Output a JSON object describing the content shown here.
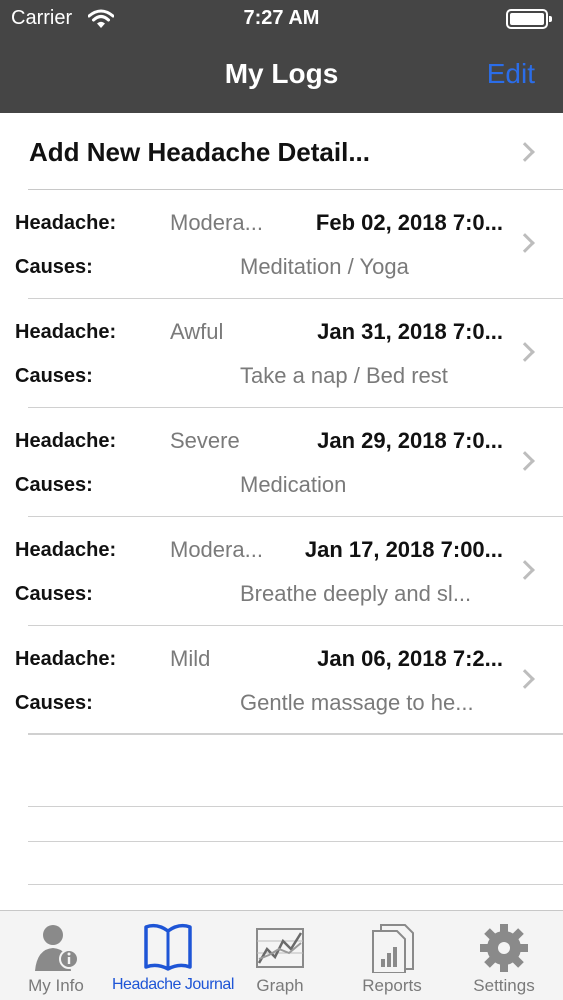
{
  "status_bar": {
    "carrier": "Carrier",
    "time": "7:27 AM"
  },
  "nav": {
    "title": "My Logs",
    "edit_label": "Edit",
    "accent": "#2b6de8"
  },
  "add_row": {
    "label": "Add New Headache Detail..."
  },
  "row_labels": {
    "headache": "Headache:",
    "causes": "Causes:"
  },
  "logs": [
    {
      "severity": "Modera...",
      "date": "Feb 02, 2018 7:0...",
      "cause": "Meditation / Yoga"
    },
    {
      "severity": "Awful",
      "date": "Jan 31, 2018 7:0...",
      "cause": "Take a nap / Bed rest"
    },
    {
      "severity": "Severe",
      "date": "Jan 29, 2018 7:0...",
      "cause": "Medication"
    },
    {
      "severity": "Modera...",
      "date": "Jan 17, 2018 7:00...",
      "cause": "Breathe deeply and sl..."
    },
    {
      "severity": "Mild",
      "date": "Jan 06, 2018 7:2...",
      "cause": "Gentle massage to he..."
    }
  ],
  "tabs": [
    {
      "label": "My Info",
      "icon": "person-info-icon"
    },
    {
      "label": "Headache Journal",
      "icon": "open-book-icon",
      "active": true
    },
    {
      "label": "Graph",
      "icon": "line-graph-icon"
    },
    {
      "label": "Reports",
      "icon": "report-document-icon"
    },
    {
      "label": "Settings",
      "icon": "gear-icon"
    }
  ],
  "colors": {
    "nav_bg": "#454545",
    "active_tab": "#1e55d6",
    "muted_text": "#7a7a7a"
  }
}
